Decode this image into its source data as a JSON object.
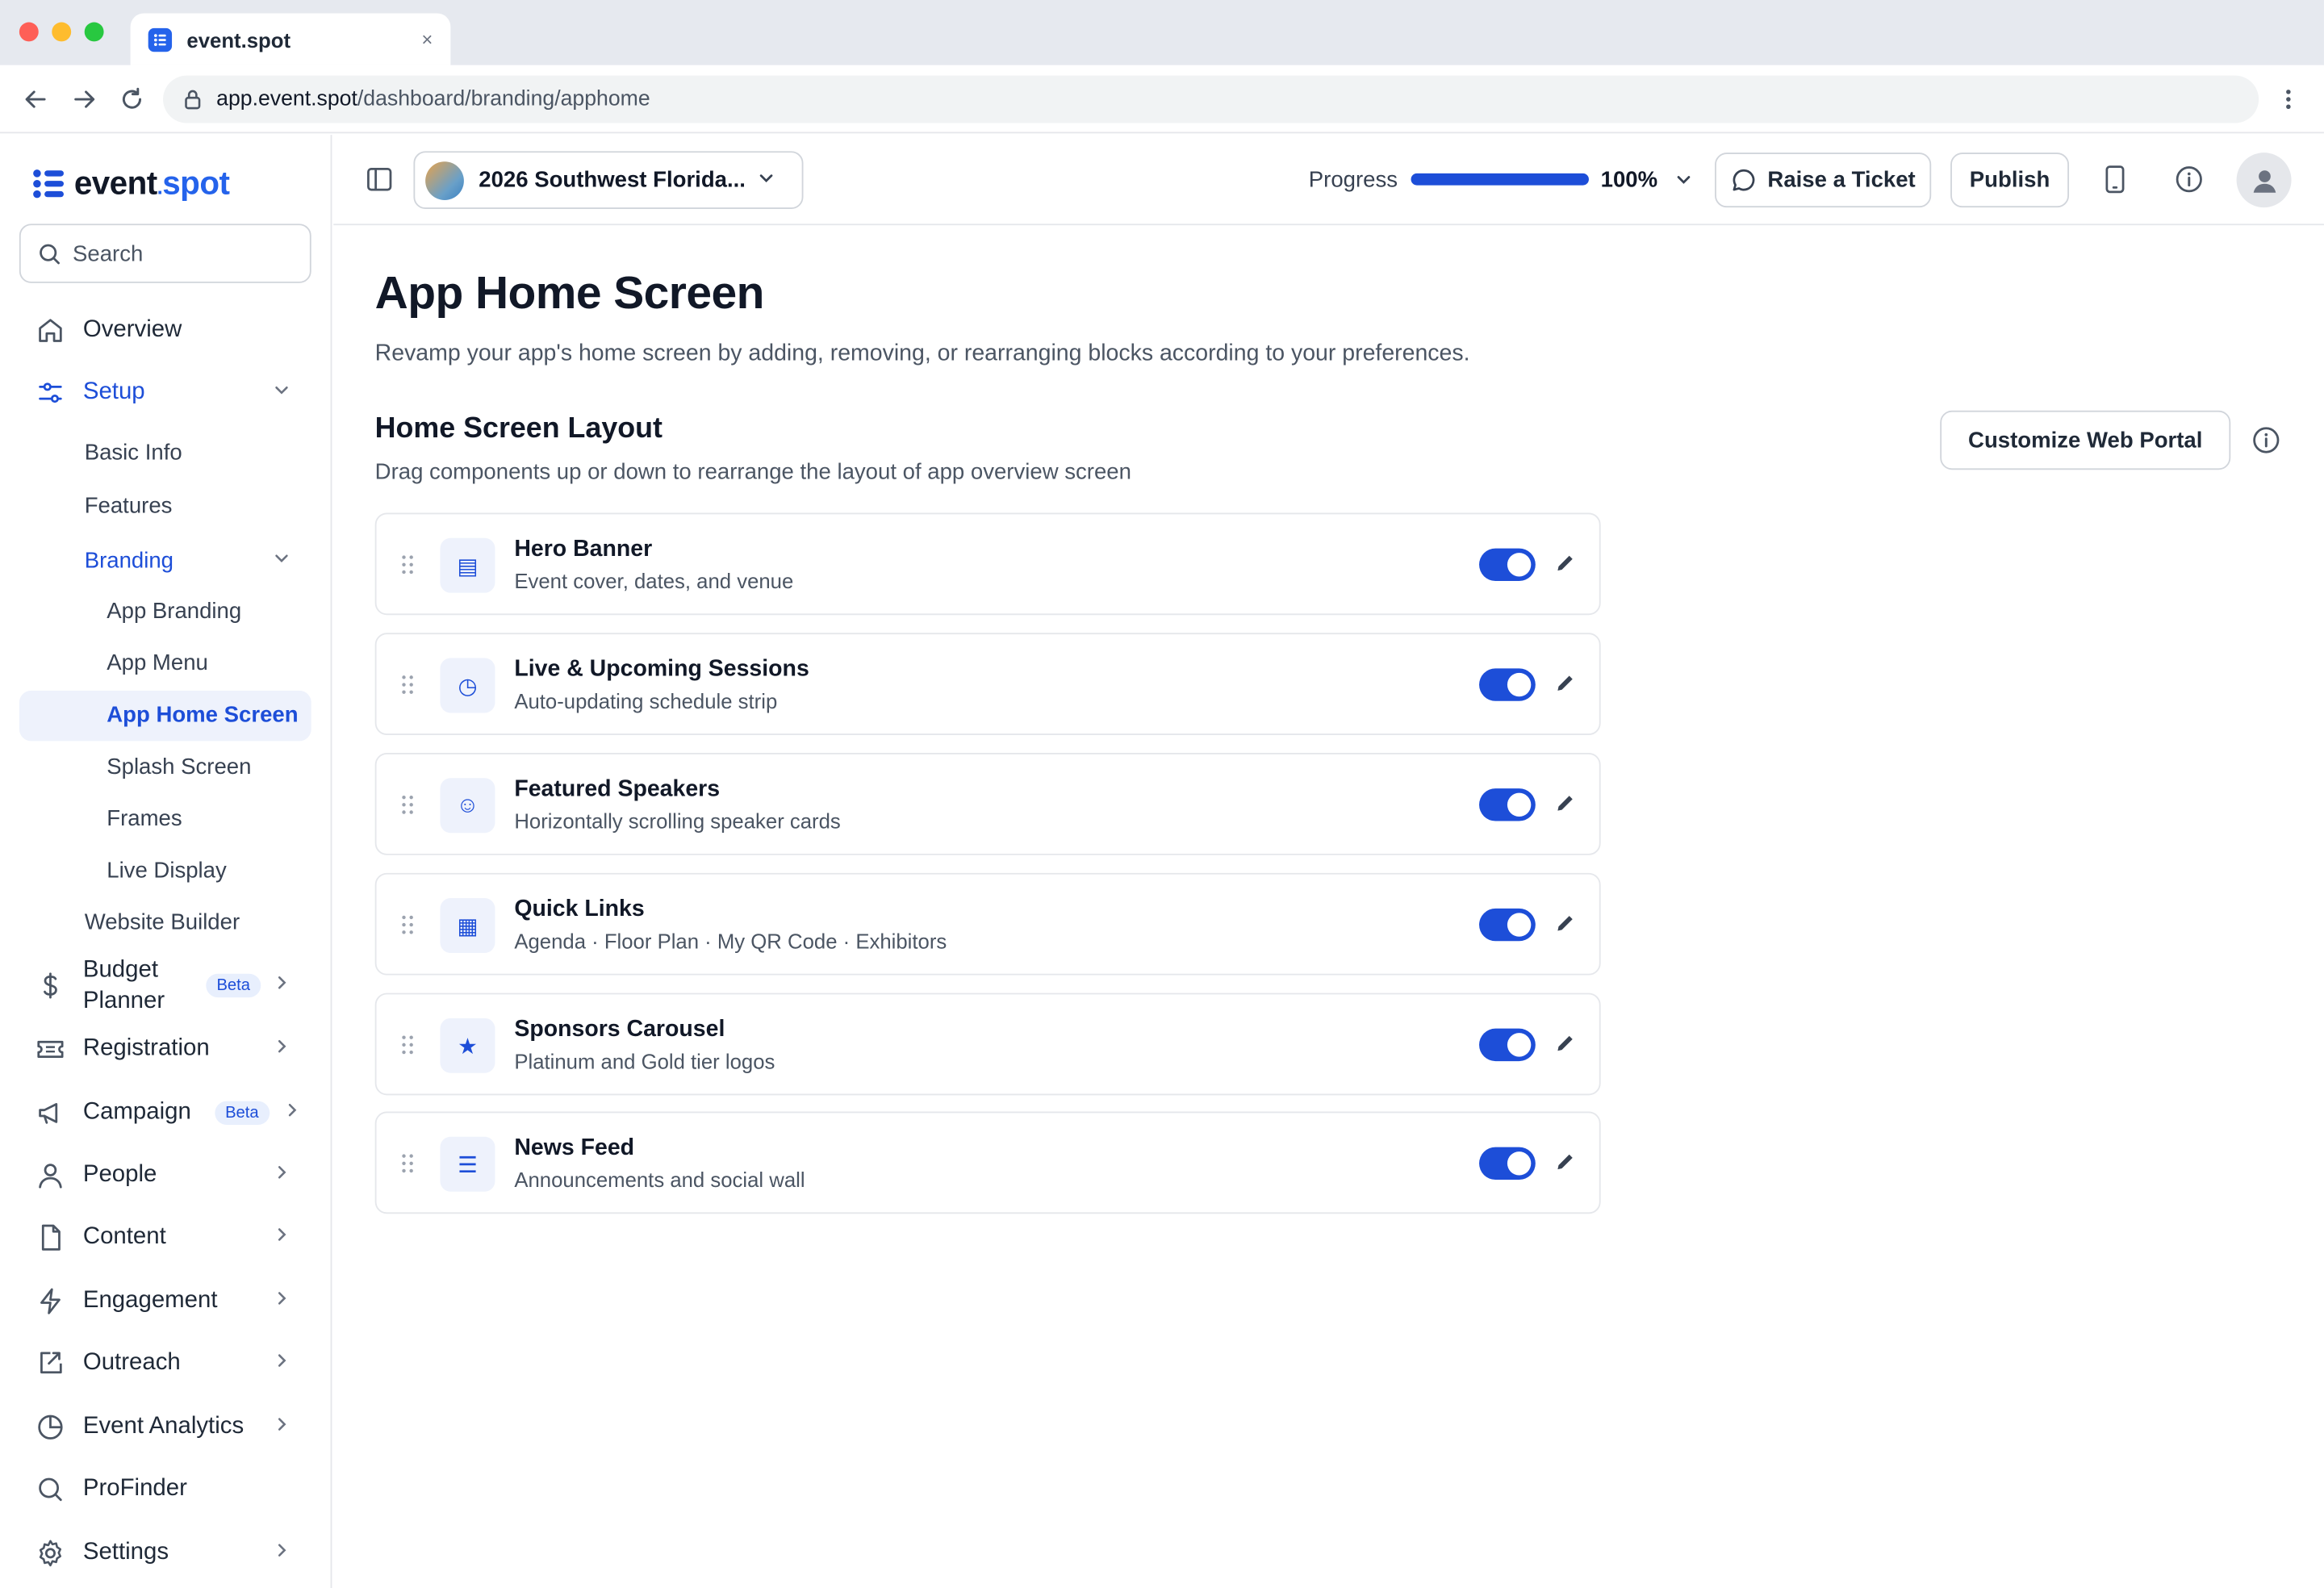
{
  "browser": {
    "tab_title": "event.spot",
    "tab_close": "×",
    "url_host": "app.event.spot",
    "url_path": "/dashboard/branding/apphome"
  },
  "brand": {
    "name_left": "event",
    "name_sep": ".",
    "name_right": "spot",
    "accent_color": "#1d4ed8"
  },
  "sidebar": {
    "search_placeholder": "Search",
    "overview": "Overview",
    "setup": "Setup",
    "basic_info": "Basic Info",
    "features": "Features",
    "branding": "Branding",
    "app_branding": "App Branding",
    "app_menu": "App Menu",
    "app_home_screen": "App Home Screen",
    "splash_screen": "Splash Screen",
    "frames": "Frames",
    "live_display": "Live Display",
    "website_builder": "Website Builder",
    "budget_planner_1": "Budget",
    "budget_planner_2": "Planner",
    "budget_badge": "Beta",
    "registration": "Registration",
    "campaign": "Campaign",
    "campaign_badge": "Beta",
    "people": "People",
    "content": "Content",
    "engagement": "Engagement",
    "outreach": "Outreach",
    "event_analytics": "Event Analytics",
    "profinder": "ProFinder",
    "settings": "Settings"
  },
  "header": {
    "event_name": "2026 Southwest Florida...",
    "progress_label": "Progress",
    "progress_value": "100%",
    "progress_fraction": 1.0,
    "raise_ticket": "Raise a Ticket",
    "publish": "Publish"
  },
  "main": {
    "title": "App Home Screen",
    "subtitle": "Revamp your app's home screen by adding, removing, or rearranging blocks according to your preferences.",
    "section_title": "Home Screen Layout",
    "section_subtitle": "Drag components up or down to rearrange the layout of app overview screen",
    "customize_button": "Customize Web Portal",
    "blocks": [
      {
        "icon": "banner-icon",
        "glyph": "▤",
        "title": "Hero Banner",
        "subtitle": "Event cover, dates, and venue",
        "enabled": true
      },
      {
        "icon": "clock-icon",
        "glyph": "◷",
        "title": "Live & Upcoming Sessions",
        "subtitle": "Auto-updating schedule strip",
        "enabled": true
      },
      {
        "icon": "smiley-icon",
        "glyph": "☺",
        "title": "Featured Speakers",
        "subtitle": "Horizontally scrolling speaker cards",
        "enabled": true
      },
      {
        "icon": "grid-icon",
        "glyph": "▦",
        "title": "Quick Links",
        "subtitle": "Agenda · Floor Plan · My QR Code · Exhibitors",
        "enabled": true
      },
      {
        "icon": "star-icon",
        "glyph": "★",
        "title": "Sponsors Carousel",
        "subtitle": "Platinum and Gold tier logos",
        "enabled": true
      },
      {
        "icon": "list-icon",
        "glyph": "☰",
        "title": "News Feed",
        "subtitle": "Announcements and social wall",
        "enabled": true
      }
    ]
  }
}
